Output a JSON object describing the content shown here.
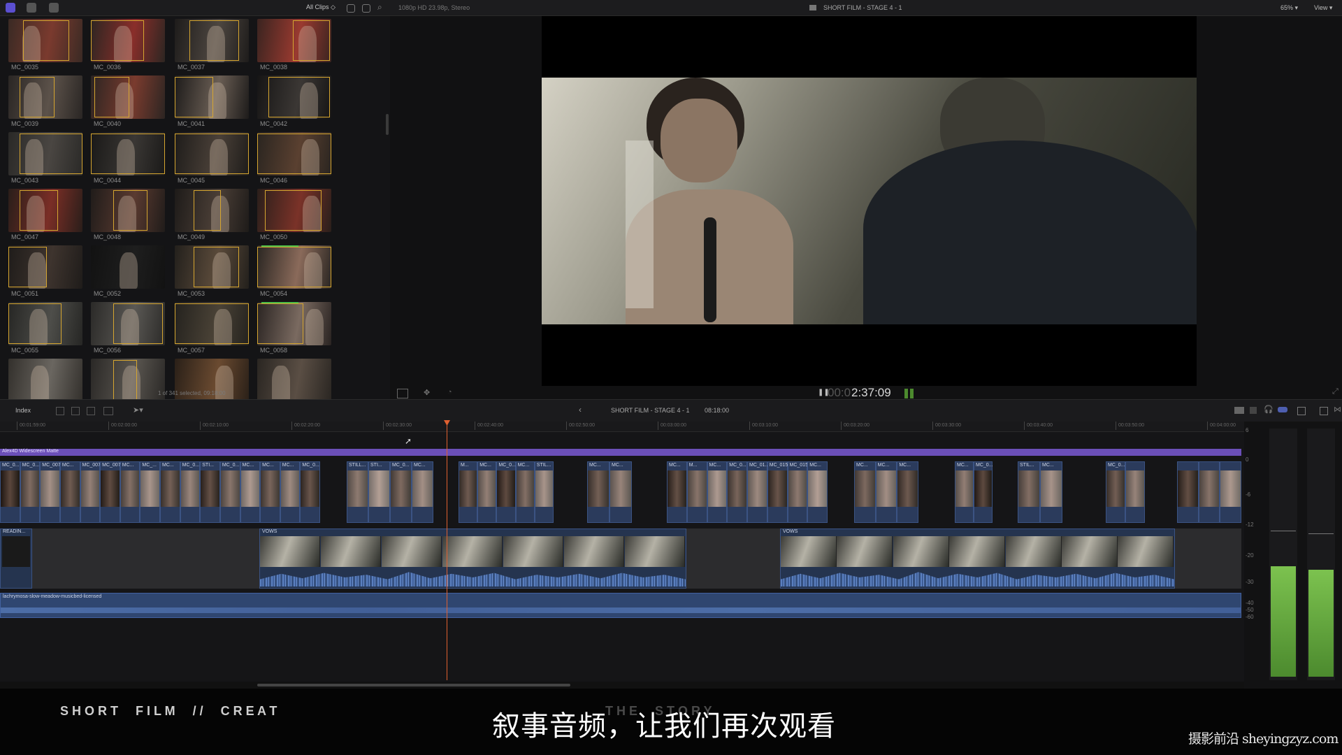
{
  "topbar": {
    "clips_filter": "All Clips ◇",
    "format_info": "1080p HD 23.98p, Stereo",
    "project_title": "SHORT FILM - STAGE  4  - 1",
    "zoom": "65% ▾",
    "view_menu": "View ▾"
  },
  "browser": {
    "clips": [
      "MC_0035",
      "MC_0036",
      "MC_0037",
      "MC_0038",
      "MC_0039",
      "MC_0040",
      "MC_0041",
      "MC_0042",
      "MC_0043",
      "MC_0044",
      "MC_0045",
      "MC_0046",
      "MC_0047",
      "MC_0048",
      "MC_0049",
      "MC_0050",
      "MC_0051",
      "MC_0052",
      "MC_0053",
      "MC_0054",
      "MC_0055",
      "MC_0056",
      "MC_0057",
      "MC_0058",
      "",
      "",
      "",
      ""
    ],
    "status": "1 of 341 selected, 09:18:00"
  },
  "viewer": {
    "timecode_dim": "00:0",
    "timecode": "2:37:09"
  },
  "timeline_toolbar": {
    "index_label": "Index",
    "back_arrow": "‹",
    "project_name": "SHORT FILM - STAGE  4  - 1",
    "duration": "08:18:00"
  },
  "timeline": {
    "ruler": [
      "00:01:59:00",
      "00:02:00:00",
      "00:02:10:00",
      "00:02:20:00",
      "00:02:30:00",
      "00:02:40:00",
      "00:02:50:00",
      "00:03:00:00",
      "00:03:10:00",
      "00:03:20:00",
      "00:03:30:00",
      "00:03:40:00",
      "00:03:50:00",
      "00:04:00:00"
    ],
    "title_bar": "Alex4D Widescreen Matte",
    "video_labels": [
      "MC_0...",
      "MC_0...",
      "MC_0070",
      "MC...",
      "MC_0077",
      "MC_0075",
      "MC...",
      "MC_...",
      "MC...",
      "MC_0...",
      "STI...",
      "MC_0...",
      "MC...",
      "MC...",
      "MC...",
      "MC_0...",
      "STILL...",
      "STI...",
      "MC_0...",
      "MC...",
      "M...",
      "MC...",
      "MC_0...",
      "MC...",
      "STIL...",
      "MC...",
      "MC...",
      "MC...",
      "M...",
      "MC...",
      "MC_0...",
      "MC_01...",
      "MC_0159",
      "MC_0159",
      "MC...",
      "MC...",
      "MC...",
      "MC...",
      "MC...",
      "MC_0...",
      "STIL...",
      "MC...",
      "MC_0..."
    ],
    "audio_labels": [
      "READIN...",
      "VOWS",
      "VOWS"
    ],
    "music_label": "lachrymosa-slow-meadow-musicbed-licensed"
  },
  "meters": {
    "scale": [
      "6",
      "0",
      "-6",
      "-12",
      "-20",
      "-30",
      "-40",
      "-50",
      "-60"
    ]
  },
  "overlay": {
    "film_title": "S H O R T     F I L M     / /     C R E A T",
    "film_title_rest": "T H E     S T O R Y",
    "subtitle": "叙事音频，让我们再次观看",
    "watermark": "摄影前沿 sheyingzyz.com"
  },
  "colors": {
    "accent_purple": "#6b4fb8",
    "clip_blue": "#2b3b5c",
    "playhead": "#e06030",
    "meter_green": "#5fae3a",
    "selection_gold": "#d6a630"
  }
}
